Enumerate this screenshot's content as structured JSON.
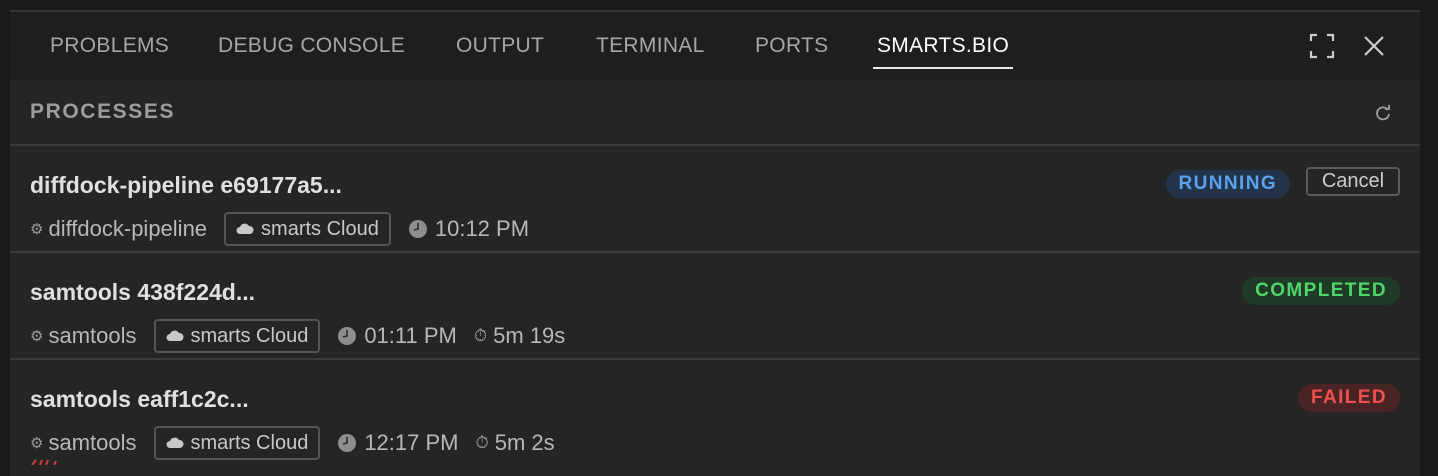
{
  "tabs": [
    {
      "label": "PROBLEMS"
    },
    {
      "label": "DEBUG CONSOLE"
    },
    {
      "label": "OUTPUT"
    },
    {
      "label": "TERMINAL"
    },
    {
      "label": "PORTS"
    },
    {
      "label": "SMARTS.BIO",
      "active": true
    }
  ],
  "toolbar": {
    "maximize_icon": "maximize-icon",
    "close_icon": "close-icon"
  },
  "section": {
    "title": "PROCESSES",
    "refresh_icon": "refresh-icon"
  },
  "processes": [
    {
      "title": "diffdock-pipeline e69177a5...",
      "pipeline": "diffdock-pipeline",
      "location": "smarts Cloud",
      "time": "10:12 PM",
      "duration": "",
      "status": "RUNNING",
      "cancel_label": "Cancel"
    },
    {
      "title": "samtools 438f224d...",
      "pipeline": "samtools",
      "location": "smarts Cloud",
      "time": "01:11 PM",
      "duration": "5m 19s",
      "status": "COMPLETED"
    },
    {
      "title": "samtools eaff1c2c...",
      "pipeline": "samtools",
      "location": "smarts Cloud",
      "time": "12:17 PM",
      "duration": "5m 2s",
      "status": "FAILED"
    }
  ],
  "colors": {
    "running": "#5aa2ee",
    "completed": "#4fd66a",
    "failed": "#f0504f",
    "panel_bg": "#252526",
    "tabbar_bg": "#1e1e1e"
  }
}
